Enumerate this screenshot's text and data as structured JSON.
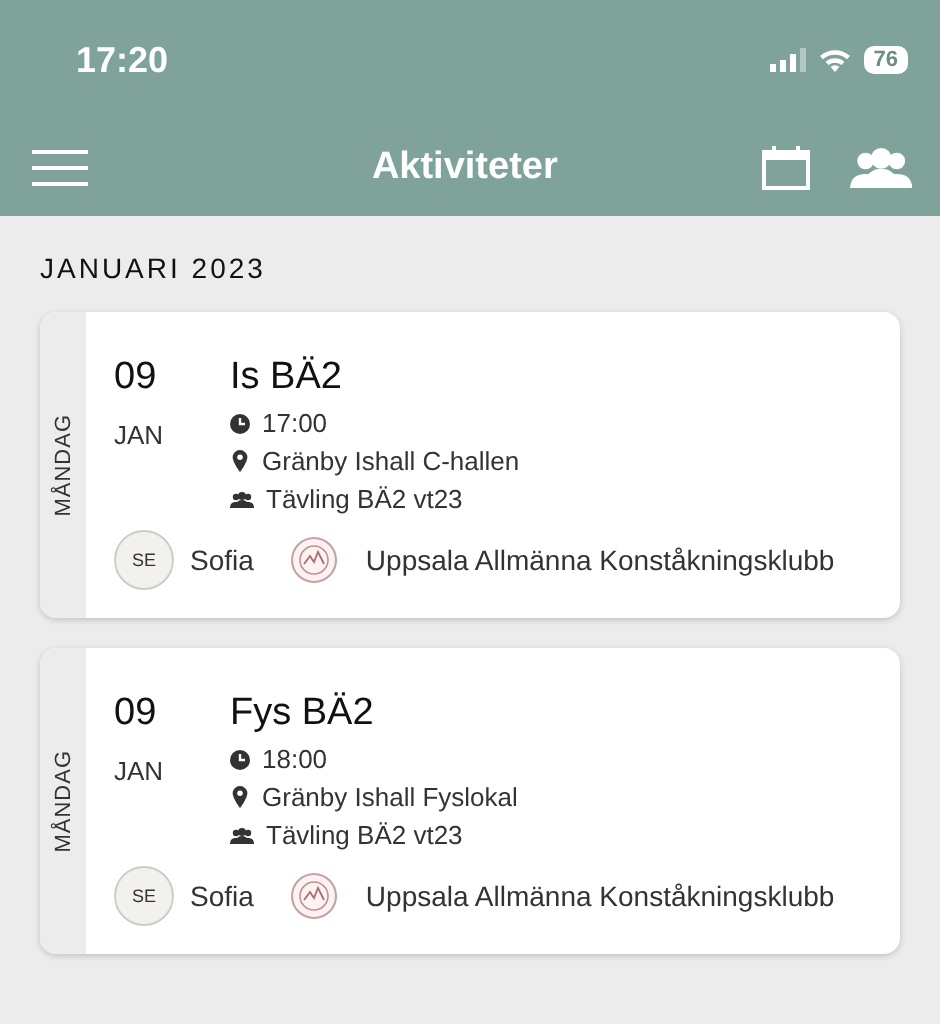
{
  "status_bar": {
    "time": "17:20",
    "battery": "76"
  },
  "header": {
    "title": "Aktiviteter"
  },
  "month": "JANUARI 2023",
  "activities": [
    {
      "weekday": "MÅNDAG",
      "day": "09",
      "month": "JAN",
      "title": "Is BÄ2",
      "time": "17:00",
      "location": "Gränby Ishall C-hallen",
      "group": "Tävling BÄ2 vt23",
      "initials": "SE",
      "person": "Sofia",
      "club": "Uppsala Allmänna Konståkningsklubb"
    },
    {
      "weekday": "MÅNDAG",
      "day": "09",
      "month": "JAN",
      "title": "Fys BÄ2",
      "time": "18:00",
      "location": "Gränby Ishall Fyslokal",
      "group": "Tävling BÄ2 vt23",
      "initials": "SE",
      "person": "Sofia",
      "club": "Uppsala Allmänna Konståkningsklubb"
    }
  ]
}
